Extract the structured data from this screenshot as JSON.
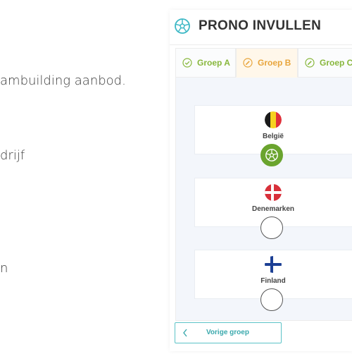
{
  "background_text": {
    "line1": "ambuilding aanbod.",
    "line2": "drijf",
    "line3": "n"
  },
  "panel": {
    "title": "PRONO INVULLEN",
    "icon": "soccer-ball-icon"
  },
  "tabs": [
    {
      "label": "Groep A",
      "status": "check-icon",
      "active": false
    },
    {
      "label": "Groep B",
      "status": "pencil-icon",
      "active": true
    },
    {
      "label": "Groep C",
      "status": "pencil-icon",
      "active": false
    }
  ],
  "teams": [
    {
      "name": "België",
      "flag": "belgium-flag-icon",
      "selected": true
    },
    {
      "name": "Denemarken",
      "flag": "denmark-flag-icon",
      "selected": false
    },
    {
      "name": "Finland",
      "flag": "finland-flag-icon",
      "selected": false
    }
  ],
  "footer": {
    "prev_label": "Vorige groep"
  },
  "colors": {
    "green": "#6aa42e",
    "tab_green": "#88b73c",
    "tab_orange": "#e8a53c",
    "teal": "#3aa9ad",
    "logo_teal": "#3fb9c6"
  }
}
